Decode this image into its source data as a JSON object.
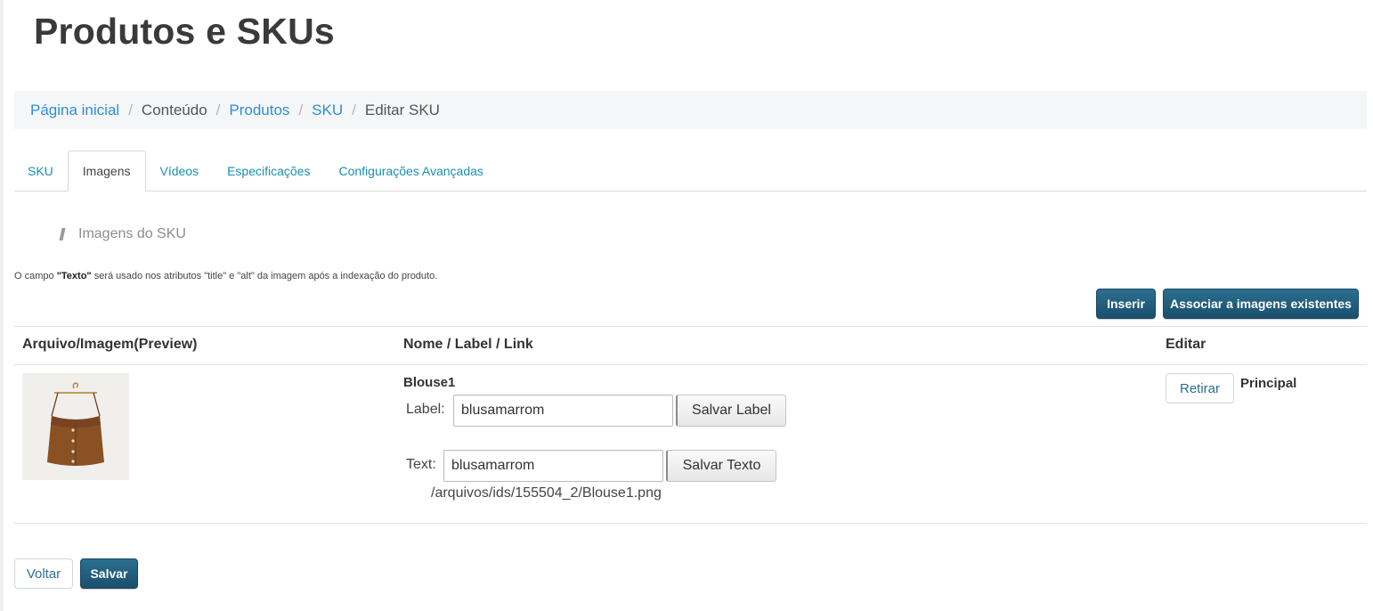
{
  "header": {
    "title": "Produtos e SKUs"
  },
  "breadcrumb": {
    "items": [
      {
        "label": "Página inicial",
        "link": true
      },
      {
        "label": "Conteúdo",
        "link": false
      },
      {
        "label": "Produtos",
        "link": true
      },
      {
        "label": "SKU",
        "link": true
      },
      {
        "label": "Editar SKU",
        "link": false
      }
    ],
    "separator": "/"
  },
  "tabs": [
    {
      "label": "SKU",
      "active": false
    },
    {
      "label": "Imagens",
      "active": true
    },
    {
      "label": "Vídeos",
      "active": false
    },
    {
      "label": "Especificações",
      "active": false
    },
    {
      "label": "Configurações Avançadas",
      "active": false
    }
  ],
  "section": {
    "title": "Imagens do SKU"
  },
  "help": {
    "prefix": "O campo ",
    "field": "\"Texto\"",
    "suffix": " será usado nos atributos \"title\" e \"alt\" da imagem após a indexação do produto."
  },
  "actions": {
    "insert": "Inserir",
    "associate": "Associar a imagens existentes"
  },
  "table": {
    "headers": {
      "file": "Arquivo/Imagem(Preview)",
      "name": "Nome / Label / Link",
      "edit": "Editar"
    },
    "rows": [
      {
        "name": "Blouse1",
        "label_caption": "Label:",
        "label_value": "blusamarrom",
        "save_label": "Salvar Label",
        "text_caption": "Text:",
        "text_value": "blusamarrom",
        "save_text": "Salvar Texto",
        "path": "/arquivos/ids/155504_2/Blouse1.png",
        "remove": "Retirar",
        "main": "Principal"
      }
    ]
  },
  "footer": {
    "back": "Voltar",
    "save": "Salvar"
  },
  "colors": {
    "link": "#2d8fd6",
    "tab": "#1a8fb0",
    "primary_button": "#1f5b7a"
  }
}
